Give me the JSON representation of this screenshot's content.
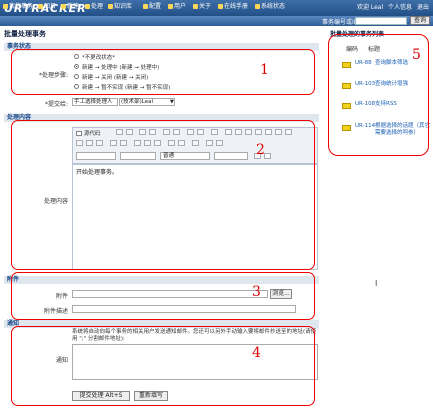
{
  "header": {
    "logo": "URTRACKER",
    "welcome": "欢迎 Leal",
    "personal_info": "个人信息",
    "logout": "退出"
  },
  "nav": {
    "items": [
      "我的事务",
      "回目",
      "新建",
      "处理",
      "知识库",
      "配置",
      "用户",
      "关于",
      "在线手册",
      "系统状态"
    ],
    "search_label": "事务编号或ID:",
    "search_button": "查询"
  },
  "page_title": "批量处理事务",
  "status_section": {
    "header": "事务状态",
    "flow_label": "*处理步骤:",
    "options": [
      "*不更改状态*",
      "新建 → 处理中 (新建 → 处理中)",
      "新建 → 关闭 (新建 → 关闭)",
      "新建 → 暂不实现 (新建 → 暂不实现)"
    ],
    "selected_index": 1,
    "assignee_label": "*提交给:",
    "assignee_value": "手工选择处理人",
    "assignee_select": "(技术部)Leal"
  },
  "content_section": {
    "header": "处理内容",
    "field_label": "处理内容",
    "toolbar_top": [
      "源代码"
    ],
    "font_select": "",
    "size_select": "普通",
    "editor_text": "开始处理事务。"
  },
  "attachment_section": {
    "header": "附件",
    "attach_label": "附件",
    "browse_button": "浏览...",
    "desc_label": "附件描述"
  },
  "notify_section": {
    "header": "通知",
    "label": "通知",
    "text": "系统将自动向每个事务的相关用户发送通知邮件。您还可以另外手动输入要将邮件抄送至的地址(请使用 \";\" 分割邮件地址):"
  },
  "actions": {
    "submit": "提交处理 Alt+S",
    "reset": "重新填写"
  },
  "right_panel": {
    "title": "批量处理的事务列表",
    "col_code": "编码",
    "col_title": "标题",
    "rows": [
      {
        "code": "UR-88",
        "title": "查询脚本筛选"
      },
      {
        "code": "UR-103",
        "title": "查询统计增强"
      },
      {
        "code": "UR-108",
        "title": "支持RSS"
      },
      {
        "code": "UR-114",
        "title": "根据选择的话题（其它需要选择的呵参）"
      }
    ]
  },
  "annotations": [
    "1",
    "2",
    "3",
    "4",
    "5"
  ],
  "colors": {
    "header": "#224f86",
    "nav": "#2d5c95",
    "section": "#dfe6ee",
    "red": "#e00000",
    "link": "#1a5fb5"
  }
}
